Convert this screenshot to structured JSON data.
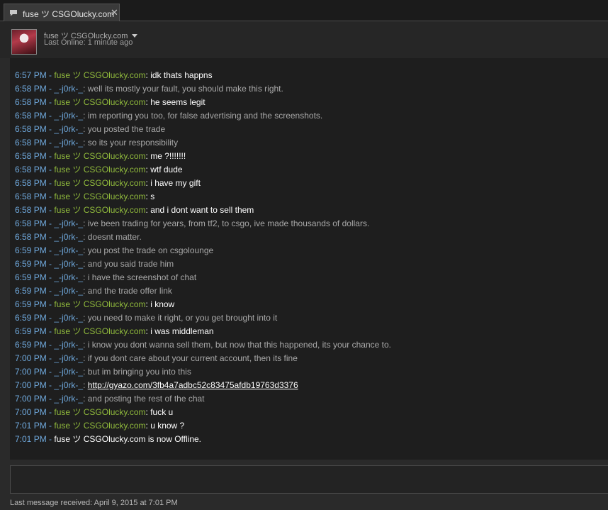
{
  "tab": {
    "icon": "chat-bubble-icon",
    "title": "fuse ツ CSGOlucky.com",
    "close": "✕"
  },
  "header": {
    "name": "fuse ツ CSGOlucky.com",
    "status": "Last Online: 1 minute ago"
  },
  "colors": {
    "timestamp": "#6fa8dc",
    "fuse_name": "#90ba3c",
    "jork_name": "#6fa8dc",
    "fuse_text": "#ffffff",
    "jork_text": "#a8a8a8"
  },
  "messages": [
    {
      "time": "6:57 PM",
      "sep": " - ",
      "sender": "fuse ツ CSGOlucky.com",
      "colon": ": ",
      "text": "idk thats happns",
      "who": "fuse"
    },
    {
      "time": "6:58 PM",
      "sep": " - ",
      "sender": "_-j0rk-_",
      "colon": ": ",
      "text": "well its mostly your fault, you should make this right.",
      "who": "jork"
    },
    {
      "time": "6:58 PM",
      "sep": " - ",
      "sender": "fuse ツ CSGOlucky.com",
      "colon": ": ",
      "text": "he seems legit",
      "who": "fuse"
    },
    {
      "time": "6:58 PM",
      "sep": " - ",
      "sender": "_-j0rk-_",
      "colon": ": ",
      "text": "im reporting you too, for false advertising and the screenshots.",
      "who": "jork"
    },
    {
      "time": "6:58 PM",
      "sep": " - ",
      "sender": "_-j0rk-_",
      "colon": ": ",
      "text": "you posted the trade",
      "who": "jork"
    },
    {
      "time": "6:58 PM",
      "sep": " - ",
      "sender": "_-j0rk-_",
      "colon": ": ",
      "text": "so its your responsibility",
      "who": "jork"
    },
    {
      "time": "6:58 PM",
      "sep": " - ",
      "sender": "fuse ツ CSGOlucky.com",
      "colon": ": ",
      "text": "me ?!!!!!!!",
      "who": "fuse"
    },
    {
      "time": "6:58 PM",
      "sep": " - ",
      "sender": "fuse ツ CSGOlucky.com",
      "colon": ": ",
      "text": "wtf dude",
      "who": "fuse"
    },
    {
      "time": "6:58 PM",
      "sep": " - ",
      "sender": "fuse ツ CSGOlucky.com",
      "colon": ": ",
      "text": "i have my gift",
      "who": "fuse"
    },
    {
      "time": "6:58 PM",
      "sep": " - ",
      "sender": "fuse ツ CSGOlucky.com",
      "colon": ": ",
      "text": "s",
      "who": "fuse"
    },
    {
      "time": "6:58 PM",
      "sep": " - ",
      "sender": "fuse ツ CSGOlucky.com",
      "colon": ": ",
      "text": "and i dont want to sell them",
      "who": "fuse"
    },
    {
      "time": "6:58 PM",
      "sep": " - ",
      "sender": "_-j0rk-_",
      "colon": ": ",
      "text": "ive been trading for years, from tf2, to csgo, ive made thousands of dollars.",
      "who": "jork"
    },
    {
      "time": "6:58 PM",
      "sep": " - ",
      "sender": "_-j0rk-_",
      "colon": ": ",
      "text": "doesnt matter.",
      "who": "jork"
    },
    {
      "time": "6:59 PM",
      "sep": " - ",
      "sender": "_-j0rk-_",
      "colon": ": ",
      "text": "you post the trade on csgolounge",
      "who": "jork"
    },
    {
      "time": "6:59 PM",
      "sep": " - ",
      "sender": "_-j0rk-_",
      "colon": ": ",
      "text": "and you said trade him",
      "who": "jork"
    },
    {
      "time": "6:59 PM",
      "sep": " - ",
      "sender": "_-j0rk-_",
      "colon": ": ",
      "text": "i have the screenshot of chat",
      "who": "jork"
    },
    {
      "time": "6:59 PM",
      "sep": " - ",
      "sender": "_-j0rk-_",
      "colon": ": ",
      "text": "and the trade offer link",
      "who": "jork"
    },
    {
      "time": "6:59 PM",
      "sep": " - ",
      "sender": "fuse ツ CSGOlucky.com",
      "colon": ": ",
      "text": "i know",
      "who": "fuse"
    },
    {
      "time": "6:59 PM",
      "sep": " - ",
      "sender": "_-j0rk-_",
      "colon": ": ",
      "text": "you need to make it right, or you get brought into it",
      "who": "jork"
    },
    {
      "time": "6:59 PM",
      "sep": " - ",
      "sender": "fuse ツ CSGOlucky.com",
      "colon": ": ",
      "text": "i was middleman",
      "who": "fuse"
    },
    {
      "time": "6:59 PM",
      "sep": " - ",
      "sender": "_-j0rk-_",
      "colon": ": ",
      "text": "i know you dont wanna sell them, but now that this happened, its your chance to.",
      "who": "jork"
    },
    {
      "time": "7:00 PM",
      "sep": " - ",
      "sender": "_-j0rk-_",
      "colon": ": ",
      "text": "if you dont care about your current account, then its fine",
      "who": "jork"
    },
    {
      "time": "7:00 PM",
      "sep": " - ",
      "sender": "_-j0rk-_",
      "colon": ": ",
      "text": "but im bringing you into this",
      "who": "jork"
    },
    {
      "time": "7:00 PM",
      "sep": " - ",
      "sender": "_-j0rk-_",
      "colon": ": ",
      "text": "http://gyazo.com/3fb4a7adbc52c83475afdb19763d3376",
      "who": "jork",
      "link": true
    },
    {
      "time": "7:00 PM",
      "sep": " - ",
      "sender": "_-j0rk-_",
      "colon": ": ",
      "text": "and posting the rest of the chat",
      "who": "jork"
    },
    {
      "time": "7:00 PM",
      "sep": " - ",
      "sender": "fuse ツ CSGOlucky.com",
      "colon": ": ",
      "text": "fuck u",
      "who": "fuse"
    },
    {
      "time": "7:01 PM",
      "sep": " - ",
      "sender": "fuse ツ CSGOlucky.com",
      "colon": ": ",
      "text": "u know ?",
      "who": "fuse"
    }
  ],
  "system_message": {
    "time": "7:01 PM",
    "sep": " - ",
    "text": "fuse ツ CSGOlucky.com is now Offline."
  },
  "footer": {
    "last_received": "Last message received: April 9, 2015 at 7:01 PM"
  }
}
